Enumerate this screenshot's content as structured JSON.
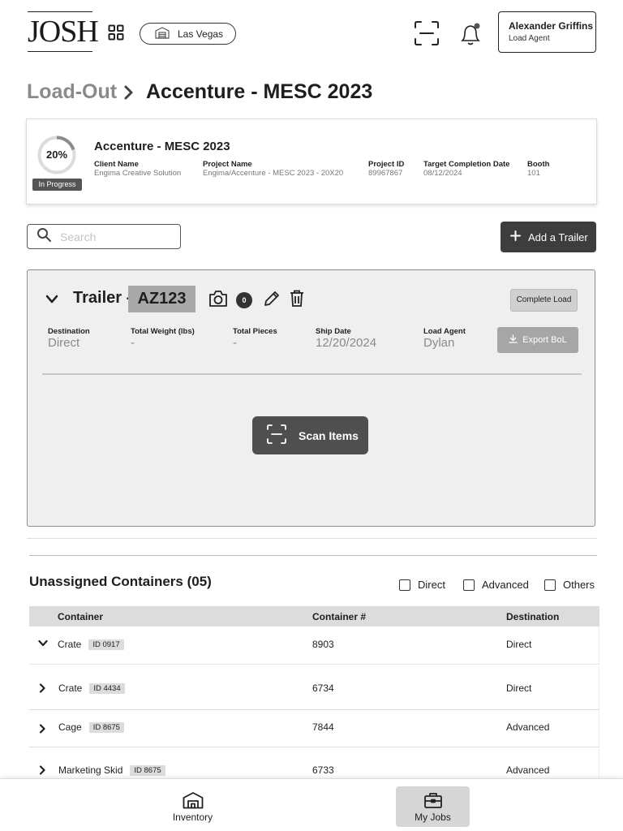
{
  "header": {
    "logo": "JOSH",
    "location": "Las Vegas",
    "user_name": "Alexander Griffins",
    "user_role": "Load Agent"
  },
  "breadcrumb": {
    "previous": "Load-Out",
    "current": "Accenture - MESC 2023"
  },
  "project": {
    "progress_label": "20%",
    "progress_value": 0.2,
    "status": "In Progress",
    "title": "Accenture - MESC 2023",
    "fields": [
      {
        "label": "Client Name",
        "value": "Engima Creative Solution"
      },
      {
        "label": "Project Name",
        "value": "Engima/Accenture - MESC 2023 - 20X20"
      },
      {
        "label": "Project ID",
        "value": "89967867"
      },
      {
        "label": "Target Completion Date",
        "value": "08/12/2024"
      },
      {
        "label": "Booth",
        "value": "101"
      }
    ]
  },
  "search": {
    "placeholder": "Search"
  },
  "add_trailer_label": "Add a Trailer",
  "trailer": {
    "prefix": "Trailer -",
    "id": "AZ123",
    "photo_count": "0",
    "complete_label": "Complete Load",
    "export_label": "Export BoL",
    "fields": [
      {
        "label": "Destination",
        "value": "Direct"
      },
      {
        "label": "Total Weight (lbs)",
        "value": "-"
      },
      {
        "label": "Total Pieces",
        "value": "-"
      },
      {
        "label": "Ship Date",
        "value": "12/20/2024"
      },
      {
        "label": "Load Agent",
        "value": "Dylan"
      }
    ],
    "scan_label": "Scan Items"
  },
  "unassigned": {
    "title": "Unassigned Containers (05)",
    "filters": [
      "Direct",
      "Advanced",
      "Others"
    ],
    "columns": [
      "Container",
      "Container #",
      "Destination"
    ],
    "rows": [
      {
        "name": "Crate",
        "id": "ID 0917",
        "number": "8903",
        "destination": "Direct"
      },
      {
        "name": "Crate",
        "id": "ID 4434",
        "number": "6734",
        "destination": "Direct"
      },
      {
        "name": "Cage",
        "id": "ID 8675",
        "number": "7844",
        "destination": "Advanced"
      },
      {
        "name": "Marketing Skid",
        "id": "ID 8675",
        "number": "6733",
        "destination": "Advanced"
      }
    ]
  },
  "nav": {
    "inventory": "Inventory",
    "my_jobs": "My Jobs"
  }
}
